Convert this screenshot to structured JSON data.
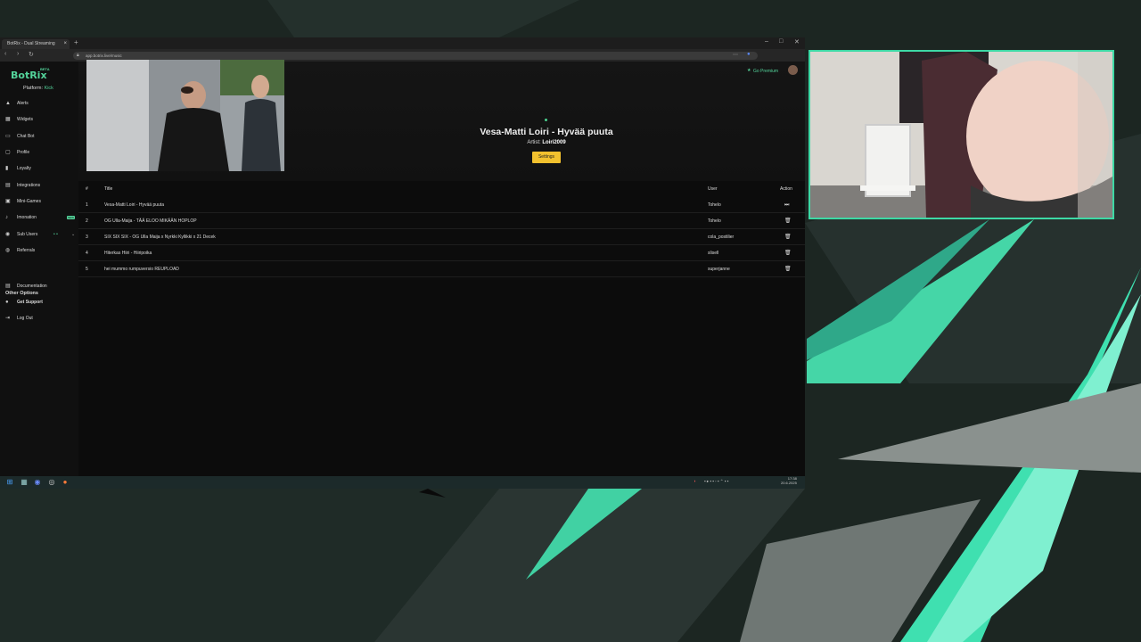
{
  "browser": {
    "tab_title": "BotRix - Dual Streaming",
    "url": "app.botrix.live/music",
    "new_tab": "+",
    "window_controls": [
      "–",
      "□",
      "✕"
    ]
  },
  "app": {
    "brand": "BotRix",
    "beta": "BETA",
    "platform_label": "Platform:",
    "platform_value": "Kick",
    "go_premium": "Go Premium",
    "nav": [
      {
        "label": "Alerts",
        "icon": "bell-icon"
      },
      {
        "label": "Widgets",
        "icon": "widgets-icon"
      },
      {
        "label": "Chat Bot",
        "icon": "chat-icon"
      },
      {
        "label": "Profile",
        "icon": "profile-icon"
      },
      {
        "label": "Loyalty",
        "icon": "loyalty-icon"
      },
      {
        "label": "Integrations",
        "icon": "integrations-icon"
      },
      {
        "label": "Mini-Games",
        "icon": "games-icon"
      },
      {
        "label": "Imonation",
        "icon": "music-icon",
        "badge": "NEW"
      },
      {
        "label": "Sub Users",
        "icon": "users-icon"
      },
      {
        "label": "Referrals",
        "icon": "referrals-icon"
      }
    ],
    "other_options_title": "Other Options",
    "other_nav": [
      {
        "label": "Documentation",
        "icon": "docs-icon"
      },
      {
        "label": "Get Support",
        "icon": "support-icon"
      },
      {
        "label": "Log Out",
        "icon": "logout-icon"
      }
    ],
    "now_playing": {
      "title": "Vesa-Matti Loiri - Hyvää puuta",
      "artist_label": "Artist:",
      "artist": "Loiri2009",
      "settings_button": "Settings"
    },
    "queue": {
      "headers": {
        "num": "#",
        "title": "Title",
        "user": "User",
        "action": "Action"
      },
      "rows": [
        {
          "num": "1",
          "title": "Vesa-Matti Loiri - Hyvää puuta",
          "user": "Tohelo",
          "action": "skip"
        },
        {
          "num": "2",
          "title": "OG Ulla-Maija - TÄÄ ELOO MIKÄÄN HOPLOP",
          "user": "Tohelo",
          "action": "delete"
        },
        {
          "num": "3",
          "title": "SIX SIX SIX - OG Ulla Maija x Nyrkki Kyllikki x 21 Decek",
          "user": "cola_postilier",
          "action": "delete"
        },
        {
          "num": "4",
          "title": "Hiterkas Hiiri - Hiiripoika",
          "user": "slisell",
          "action": "delete"
        },
        {
          "num": "5",
          "title": "hei mummo rumpuversio REUPLOAD",
          "user": "superjanne",
          "action": "delete"
        }
      ]
    }
  },
  "taskbar": {
    "clock_time": "17:38",
    "clock_date": "20.6.2025"
  },
  "colors": {
    "accent": "#53d39a",
    "settings_button": "#f2c12e",
    "cam_border": "#3dd9a5"
  }
}
